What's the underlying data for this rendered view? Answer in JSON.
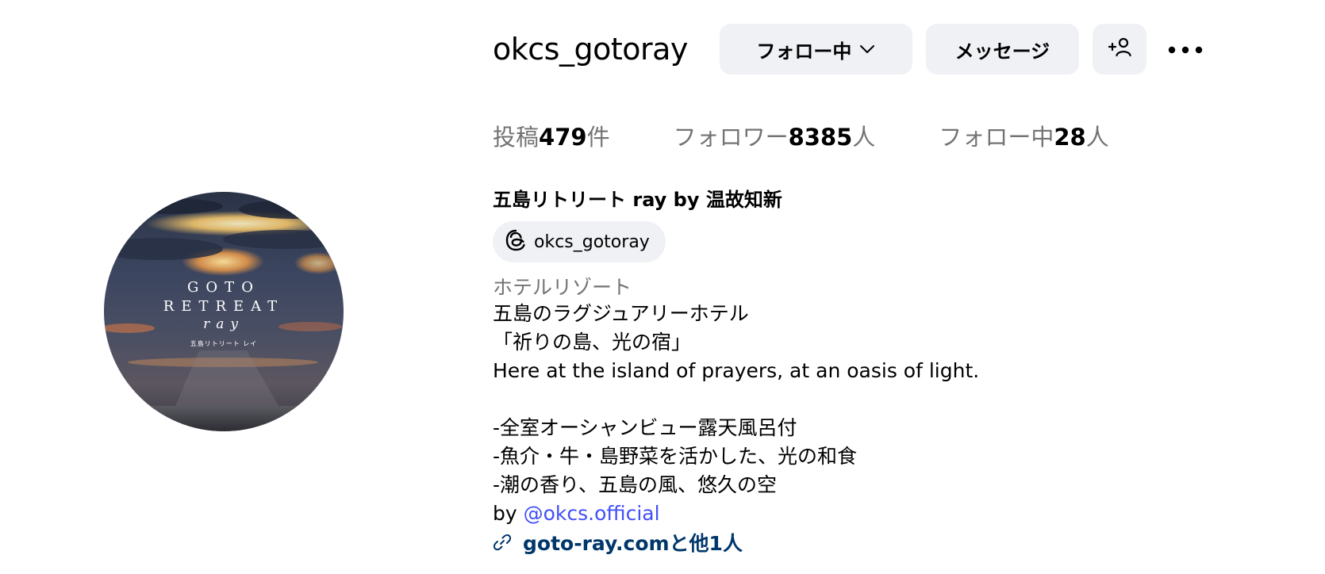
{
  "profile": {
    "username": "okcs_gotoray",
    "avatar_text": {
      "line1": "GOTO",
      "line2": "RETREAT",
      "line3": "ray",
      "line4": "五島リトリート レイ"
    }
  },
  "actions": {
    "follow_label": "フォロー中",
    "message_label": "メッセージ",
    "add_user_icon": "add-user-icon",
    "more_icon": "more-options-icon"
  },
  "stats": {
    "posts_prefix": "投稿",
    "posts_count": "479",
    "posts_suffix": "件",
    "followers_prefix": "フォロワー",
    "followers_count": "8385",
    "followers_suffix": "人",
    "following_prefix": "フォロー中",
    "following_count": "28",
    "following_suffix": "人"
  },
  "bio": {
    "name": "五島リトリート ray by 温故知新",
    "threads_handle": "okcs_gotoray",
    "category": "ホテルリゾート",
    "lines": [
      "五島のラグジュアリーホテル",
      "「祈りの島、光の宿」",
      "Here at the island of prayers, at an oasis of light.",
      "",
      "-全室オーシャンビュー露天風呂付",
      "-魚介・牛・島野菜を活かした、光の和食",
      "-潮の香り、五島の風、悠久の空"
    ],
    "by_prefix": "by ",
    "mention": "@okcs.official",
    "link_text": "goto-ray.comと他1人"
  },
  "colors": {
    "button_bg": "#eff1f5",
    "secondary_text": "#737373",
    "mention": "#4150f7",
    "link": "#00376b"
  }
}
